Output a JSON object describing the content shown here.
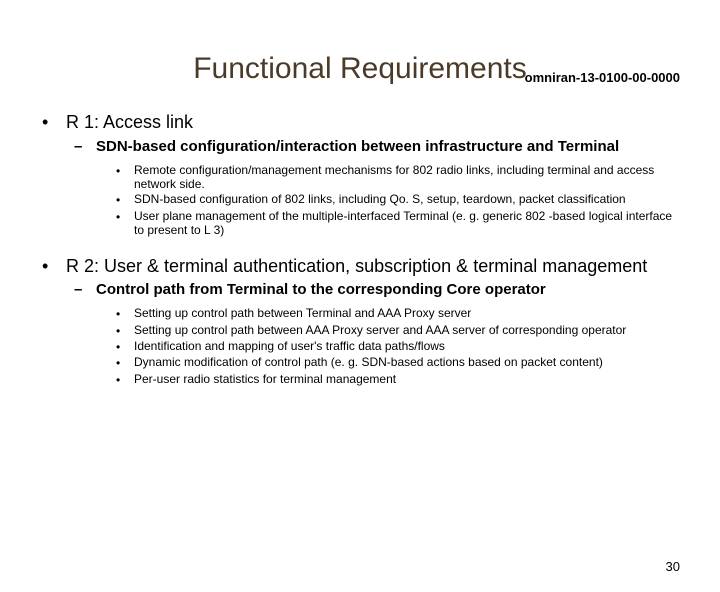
{
  "doc_id": "omniran-13-0100-00-0000",
  "title": "Functional Requirements",
  "page_number": "30",
  "sections": [
    {
      "heading": "R 1: Access link",
      "sub": {
        "heading": "SDN-based configuration/interaction between infrastructure and Terminal",
        "items": [
          "Remote configuration/management mechanisms for 802 radio links, including terminal and access network side.",
          "SDN-based configuration of 802 links, including Qo. S, setup, teardown, packet classification",
          "User plane management of the multiple-interfaced Terminal (e. g. generic 802 -based logical interface to present to L 3)"
        ]
      }
    },
    {
      "heading": "R 2: User & terminal authentication, subscription & terminal management",
      "sub": {
        "heading": "Control path from Terminal to the corresponding Core operator",
        "items": [
          "Setting up control path between Terminal and AAA Proxy server",
          "Setting up control path between AAA Proxy server and AAA server of corresponding operator",
          "Identification and mapping of user's traffic data paths/flows",
          "Dynamic modification of control path (e. g. SDN-based actions based on packet content)",
          "Per-user radio statistics for terminal management"
        ]
      }
    }
  ]
}
